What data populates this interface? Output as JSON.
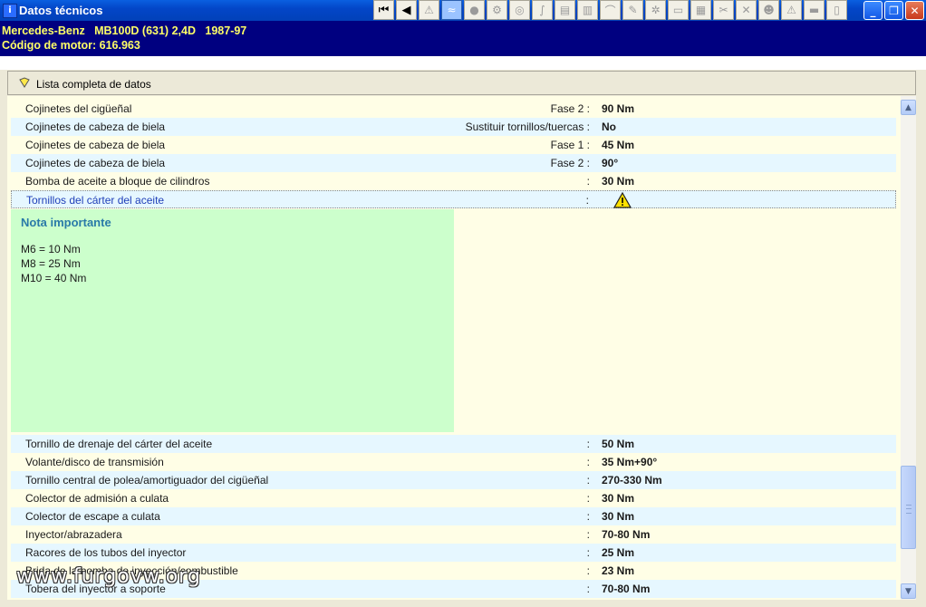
{
  "window": {
    "title": "Datos técnicos",
    "app_icon": "app-icon",
    "buttons": [
      "minimize",
      "restore",
      "close"
    ]
  },
  "toolbar": {
    "nav": [
      {
        "name": "first-icon",
        "glyph": "⏮"
      },
      {
        "name": "previous-icon",
        "glyph": "◀"
      }
    ],
    "tools": [
      {
        "name": "warning-icon",
        "glyph": "⚠"
      },
      {
        "name": "diagram-icon",
        "glyph": "≈",
        "active": true
      },
      {
        "name": "oil-drop-icon",
        "glyph": "●"
      },
      {
        "name": "engine-icon",
        "glyph": "⚙"
      },
      {
        "name": "brake-disc-icon",
        "glyph": "◎"
      },
      {
        "name": "hose-icon",
        "glyph": "∫"
      },
      {
        "name": "component-icon",
        "glyph": "▤"
      },
      {
        "name": "seat-icon",
        "glyph": "▥"
      },
      {
        "name": "wiper-icon",
        "glyph": "⌒"
      },
      {
        "name": "tool-icon",
        "glyph": "✎"
      },
      {
        "name": "gear-icon",
        "glyph": "✲"
      },
      {
        "name": "car-icon",
        "glyph": "▭"
      },
      {
        "name": "service-icon",
        "glyph": "▦"
      },
      {
        "name": "wrench-icon",
        "glyph": "✂"
      },
      {
        "name": "tools-icon",
        "glyph": "✕"
      },
      {
        "name": "person-icon",
        "glyph": "☻"
      },
      {
        "name": "alert-icon",
        "glyph": "⚠"
      },
      {
        "name": "vehicle-icon",
        "glyph": "▬"
      },
      {
        "name": "book-icon",
        "glyph": "▯"
      }
    ]
  },
  "vehicle": {
    "line1": "Mercedes-Benz   MB100D (631) 2,4D   1987-97",
    "line2": "Código de motor: 616.963"
  },
  "section": {
    "label": "Lista completa de datos",
    "icon": "diamond-icon"
  },
  "rows_top": [
    {
      "name": "Cojinetes del cigüeñal",
      "qual": "Fase 2 :",
      "val": "90 Nm"
    },
    {
      "name": "Cojinetes de cabeza de biela",
      "qual": "Sustituir tornillos/tuercas :",
      "val": "No"
    },
    {
      "name": "Cojinetes de cabeza de biela",
      "qual": "Fase 1 :",
      "val": "45 Nm"
    },
    {
      "name": "Cojinetes de cabeza de biela",
      "qual": "Fase 2 :",
      "val": "90°"
    },
    {
      "name": "Bomba de aceite a bloque de cilindros",
      "qual": ":",
      "val": "30 Nm"
    },
    {
      "name": "Tornillos del cárter del aceite",
      "qual": ":",
      "val": ""
    }
  ],
  "note": {
    "title": "Nota importante",
    "lines": [
      "M6 = 10 Nm",
      "M8 = 25 Nm",
      "M10 = 40 Nm"
    ]
  },
  "rows_bottom": [
    {
      "name": "Tornillo de drenaje del cárter del aceite",
      "qual": ":",
      "val": "50 Nm"
    },
    {
      "name": "Volante/disco de transmisión",
      "qual": ":",
      "val": "35 Nm+90°"
    },
    {
      "name": "Tornillo central de polea/amortiguador del cigüeñal",
      "qual": ":",
      "val": "270-330 Nm"
    },
    {
      "name": "Colector de admisión a culata",
      "qual": ":",
      "val": "30 Nm"
    },
    {
      "name": "Colector de escape a culata",
      "qual": ":",
      "val": "30 Nm"
    },
    {
      "name": "Inyector/abrazadera",
      "qual": ":",
      "val": "70-80 Nm"
    },
    {
      "name": "Racores de los tubos del inyector",
      "qual": ":",
      "val": "25 Nm"
    },
    {
      "name": "Brida de la bomba de inyección/combustible",
      "qual": ":",
      "val": "23 Nm"
    },
    {
      "name": "Tobera del inyector a soporte",
      "qual": ":",
      "val": "70-80 Nm"
    }
  ],
  "watermark": "www.furgovw.org",
  "colors": {
    "title_bar": "#0346c8",
    "header_band": "#000080",
    "header_text": "#ffff66",
    "row_blue": "#e6f7ff",
    "row_yellow": "#fffee6",
    "note_bg": "#ccffcc",
    "note_title": "#2a7aa8"
  }
}
